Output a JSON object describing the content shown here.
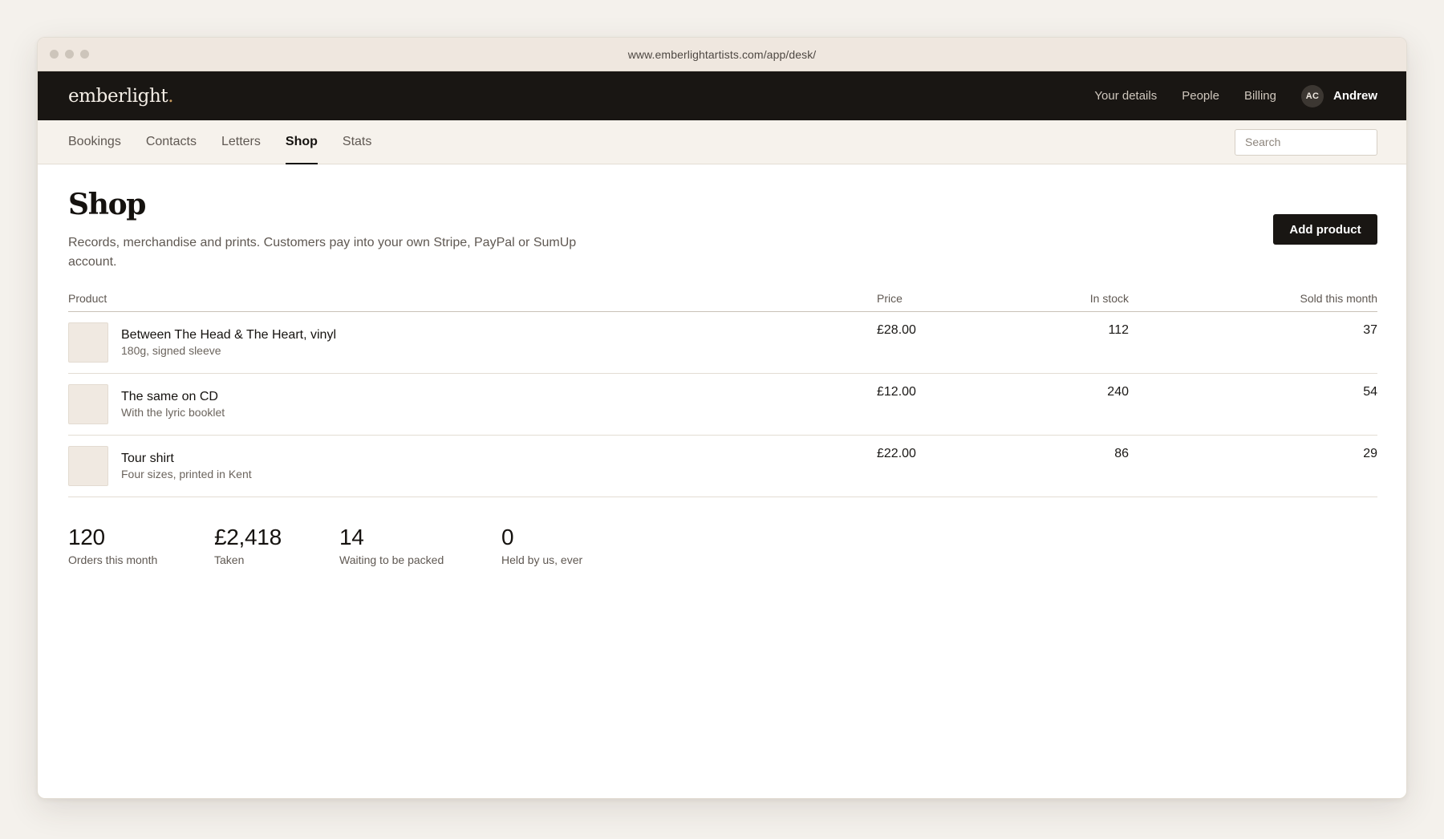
{
  "browser": {
    "url": "www.emberlightartists.com/app/desk/"
  },
  "brand": {
    "name": "emberlight",
    "dot": "."
  },
  "topnav": {
    "links": [
      "Your details",
      "People",
      "Billing"
    ],
    "user": {
      "initials": "AC",
      "name": "Andrew"
    }
  },
  "subnav": {
    "tabs": [
      "Bookings",
      "Contacts",
      "Letters",
      "Shop",
      "Stats"
    ],
    "active_tab": "Shop",
    "search_placeholder": "Search"
  },
  "page": {
    "title": "Shop",
    "description": "Records, merchandise and prints. Customers pay into your own Stripe, PayPal or SumUp account.",
    "add_button": "Add product"
  },
  "table": {
    "headers": {
      "product": "Product",
      "price": "Price",
      "stock": "In stock",
      "sold": "Sold this month"
    },
    "rows": [
      {
        "name": "Between The Head & The Heart, vinyl",
        "detail": "180g, signed sleeve",
        "price": "£28.00",
        "stock": "112",
        "sold": "37"
      },
      {
        "name": "The same on CD",
        "detail": "With the lyric booklet",
        "price": "£12.00",
        "stock": "240",
        "sold": "54"
      },
      {
        "name": "Tour shirt",
        "detail": "Four sizes, printed in Kent",
        "price": "£22.00",
        "stock": "86",
        "sold": "29"
      }
    ]
  },
  "stats": [
    {
      "value": "120",
      "label": "Orders this month"
    },
    {
      "value": "£2,418",
      "label": "Taken"
    },
    {
      "value": "14",
      "label": "Waiting to be packed"
    },
    {
      "value": "0",
      "label": "Held by us, ever"
    }
  ],
  "colors": {
    "page_background": "#f4f1ec",
    "topbar": "#191613",
    "accent_dot": "#c89a5e",
    "primary_button": "#191613",
    "thumb": "#f0e9e1"
  }
}
